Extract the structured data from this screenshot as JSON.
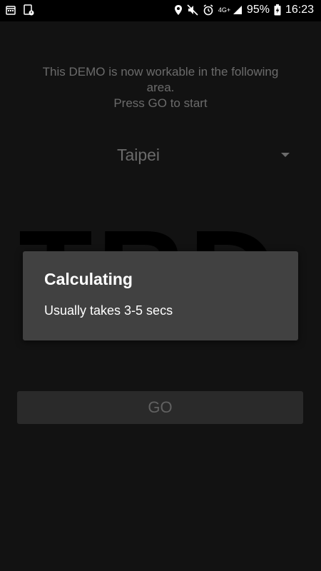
{
  "status_bar": {
    "battery_pct": "95%",
    "time": "16:23",
    "network": "4G+",
    "icons": [
      "calendar-icon",
      "sim-alert-icon",
      "location-icon",
      "mute-icon",
      "alarm-icon",
      "4g-icon",
      "signal-icon",
      "battery-charging-icon"
    ]
  },
  "main": {
    "info_line1": "This DEMO is now workable in the following",
    "info_line2": "area.",
    "info_line3": "Press GO to start",
    "city_selected": "Taipei",
    "logo_text": "TRD",
    "go_label": "GO"
  },
  "dialog": {
    "title": "Calculating",
    "message": "Usually takes 3-5 secs"
  },
  "colors": {
    "background": "#121212",
    "dialog_bg": "#414141",
    "dimmed_text": "#6b6b6b"
  }
}
